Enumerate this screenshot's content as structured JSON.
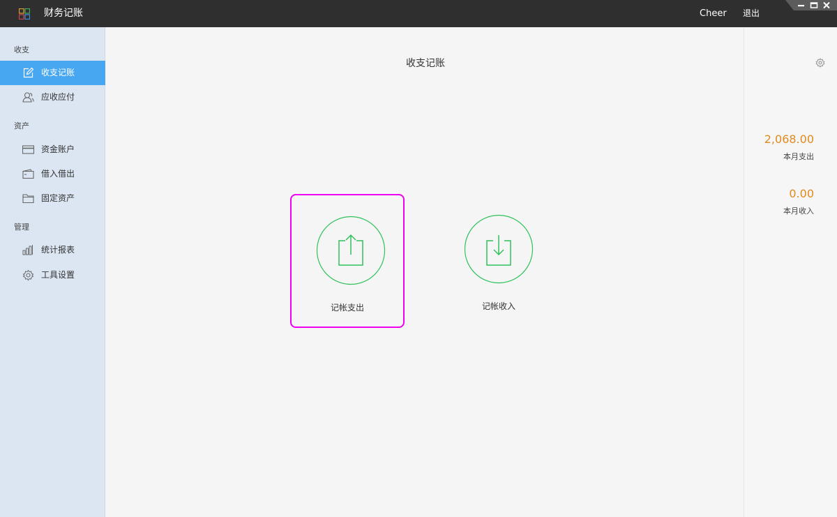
{
  "app": {
    "title": "财务记账",
    "user": "Cheer",
    "logout": "退出"
  },
  "sidebar": {
    "sections": [
      {
        "label": "收支",
        "items": [
          {
            "label": "收支记账",
            "icon": "edit-icon",
            "active": true
          },
          {
            "label": "应收应付",
            "icon": "contacts-icon"
          }
        ]
      },
      {
        "label": "资产",
        "items": [
          {
            "label": "资金账户",
            "icon": "card-icon"
          },
          {
            "label": "借入借出",
            "icon": "wallet-icon"
          },
          {
            "label": "固定资产",
            "icon": "folder-icon"
          }
        ]
      },
      {
        "label": "管理",
        "items": [
          {
            "label": "统计报表",
            "icon": "bar-chart-icon"
          },
          {
            "label": "工具设置",
            "icon": "gear-icon"
          }
        ]
      }
    ]
  },
  "main": {
    "title": "收支记账",
    "actions": [
      {
        "label": "记帐支出",
        "icon": "upload-icon"
      },
      {
        "label": "记帐收入",
        "icon": "download-icon"
      }
    ]
  },
  "stats": {
    "expense_value": "2,068.00",
    "expense_label": "本月支出",
    "income_value": "0.00",
    "income_label": "本月收入"
  },
  "colors": {
    "accent": "#48a7f1",
    "sidebar_bg": "#dce6f3",
    "titlebar_bg": "#2f2f2f",
    "icon_green": "#2fc15c",
    "stat_orange": "#e08a1e",
    "highlight": "#f000f0"
  }
}
